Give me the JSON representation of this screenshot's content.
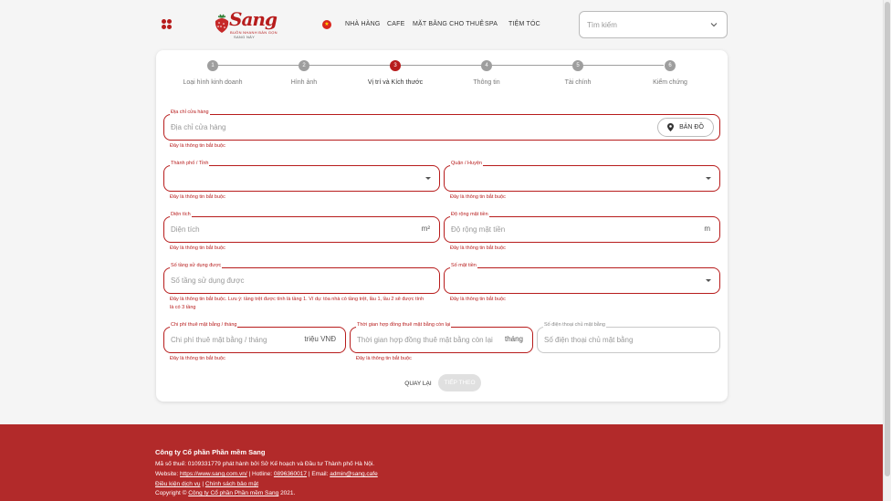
{
  "header": {
    "logo": {
      "brand": "Sang",
      "tagline": "BUÔN NHANH BÁN GỌN",
      "tagline2": "SANG NÀY"
    },
    "nav": [
      "NHÀ HÀNG",
      "CAFE",
      "MẶT BẰNG CHO THUÊ",
      "SPA",
      "TIỆM TÓC"
    ],
    "search": {
      "placeholder": "Tìm kiếm"
    },
    "colors": {
      "brand": "#b71c1c"
    }
  },
  "steps": [
    {
      "number": "1",
      "label": "Loại hình kinh doanh",
      "active": false
    },
    {
      "number": "2",
      "label": "Hình ảnh",
      "active": false
    },
    {
      "number": "3",
      "label": "Vị trí và Kích thước",
      "active": true
    },
    {
      "number": "4",
      "label": "Thông tin",
      "active": false
    },
    {
      "number": "5",
      "label": "Tài chính",
      "active": false
    },
    {
      "number": "6",
      "label": "Kiểm chứng",
      "active": false
    }
  ],
  "form": {
    "address": {
      "label": "Địa chỉ cửa hàng",
      "placeholder": "Địa chỉ cửa hàng",
      "map_button": "BẢN ĐỒ",
      "error": "Đây là thông tin bắt buộc"
    },
    "city": {
      "label": "Thành phố / Tỉnh",
      "error": "Đây là thông tin bắt buộc"
    },
    "district": {
      "label": "Quận / Huyện",
      "error": "Đây là thông tin bắt buộc"
    },
    "area": {
      "label": "Diện tích",
      "placeholder": "Diện tích",
      "unit": "m²",
      "error": "Đây là thông tin bắt buộc"
    },
    "frontage": {
      "label": "Độ rộng mặt tiền",
      "placeholder": "Độ rộng mặt tiền",
      "unit": "m",
      "error": "Đây là thông tin bắt buộc"
    },
    "floors": {
      "label": "Số tầng sử dụng được",
      "placeholder": "Số tầng sử dụng được",
      "error_line1": "Đây là thông tin bắt buộc. Lưu ý: tầng trệt được tính là tầng 1. Ví dụ: tòa nhà có tầng trệt, lầu 1, lầu 2 sẽ được tính",
      "error_line2": "là có 3 tầng"
    },
    "frontages_count": {
      "label": "Số mặt tiền",
      "error": "Đây là thông tin bắt buộc"
    },
    "rent": {
      "label": "Chi phí thuê mặt bằng / tháng",
      "placeholder": "Chi phí thuê mặt bằng / tháng",
      "unit": "triệu VNĐ",
      "error": "Đây là thông tin bắt buộc"
    },
    "lease_remaining": {
      "label": "Thời gian hợp đồng thuê mặt bằng còn lại",
      "placeholder": "Thời gian hợp đồng thuê mặt bằng còn lại",
      "unit": "tháng",
      "error": "Đây là thông tin bắt buộc"
    },
    "owner_phone": {
      "label": "Số điện thoại chủ mặt bằng",
      "placeholder": "Số điện thoại chủ mặt bằng"
    },
    "back_button": "QUAY LẠI",
    "next_button": "TIẾP THEO"
  },
  "footer": {
    "company": "Công ty Cổ phần Phần mềm Sang",
    "tax_line": "Mã số thuế: 0109331779 phát hành bởi Sở Kế hoạch và Đầu tư Thành phố Hà Nội.",
    "website_label": "Website:",
    "website": "https://www.sang.com.vn/",
    "hotline_label": "| Hotline:",
    "hotline": "0896360017",
    "email_label": "| Email:",
    "email": "admin@sang.cafe",
    "terms": "Điều kiện dịch vụ",
    "separator": "|",
    "privacy": "Chính sách bảo mật",
    "copyright_prefix": "Copyright ©",
    "copyright_company": "Công ty Cổ phần Phần mềm Sang",
    "copyright_year": "2021."
  }
}
